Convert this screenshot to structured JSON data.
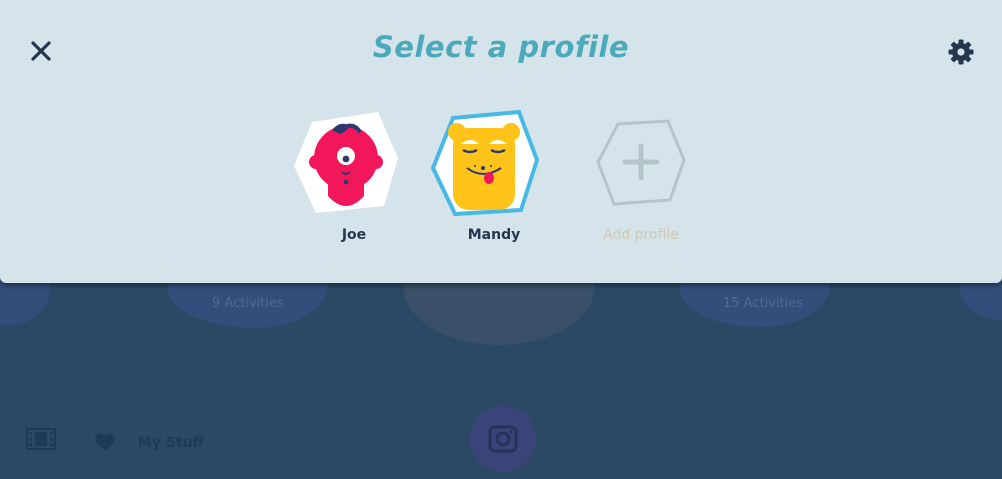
{
  "modal": {
    "title": "Select a profile",
    "close_icon": "close-icon",
    "settings_icon": "gear-icon"
  },
  "profiles": [
    {
      "name": "Joe",
      "avatar": "pink-cyclops-avatar",
      "selected": false
    },
    {
      "name": "Mandy",
      "avatar": "yellow-bear-avatar",
      "selected": true
    }
  ],
  "add_profile": {
    "label": "Add profile",
    "icon": "plus-icon"
  },
  "background": {
    "cards": [
      "9 Activities",
      "15 Activities"
    ],
    "bottom_nav": {
      "my_stuff_label": "My Stuff"
    }
  },
  "colors": {
    "title": "#4ba9ba",
    "panel": "#d5e4ea",
    "selected_ring": "#46b9e6",
    "joe_avatar": "#f2175a",
    "mandy_avatar": "#ffc31a",
    "text_dark": "#25374f"
  }
}
